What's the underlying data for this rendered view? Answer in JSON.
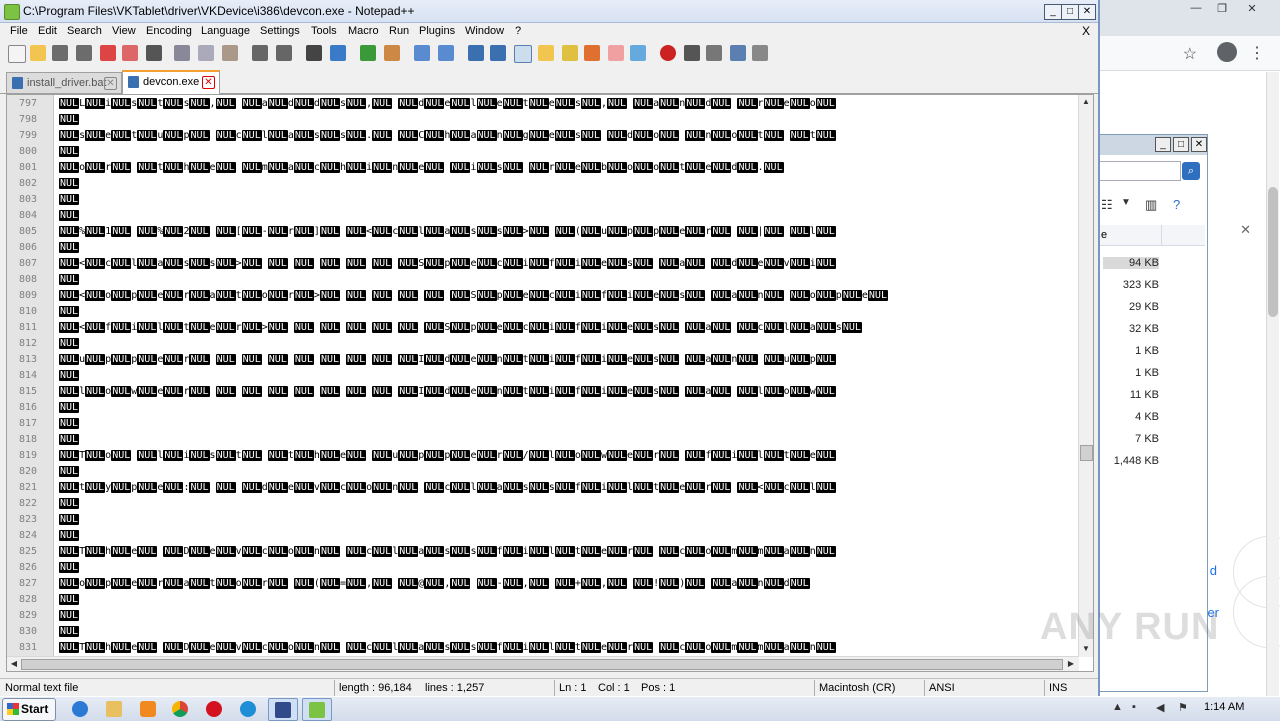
{
  "window": {
    "title": "C:\\Program Files\\VKTablet\\driver\\VKDevice\\i386\\devcon.exe - Notepad++",
    "min": "_",
    "max": "□",
    "close": "✕"
  },
  "menu": {
    "items": [
      "File",
      "Edit",
      "Search",
      "View",
      "Encoding",
      "Language",
      "Settings",
      "Tools",
      "Macro",
      "Run",
      "Plugins",
      "Window",
      "?"
    ],
    "close": "X"
  },
  "tabs": [
    {
      "label": "install_driver.bat",
      "close": "✕",
      "active": false
    },
    {
      "label": "devcon.exe",
      "close": "✕",
      "active": true
    }
  ],
  "editor": {
    "lines": [
      {
        "n": "797",
        "t": "NULLNULiNULsNULtNULsNUL,NUL NULaNULdNULdNULsNUL,NUL NULdNULeNULlNULeNULtNULeNULsNUL,NUL NULaNULnNULdNUL NULrNULeNULoNUL"
      },
      {
        "n": "798",
        "t": "NUL"
      },
      {
        "n": "799",
        "t": "NULsNULeNULtNULuNULpNUL NULcNULlNULaNULsNULsNUL.NUL NULCNULhNULaNULnNULgNULeNULsNUL NULdNULoNUL NULnNULoNULtNUL NULtNUL"
      },
      {
        "n": "800",
        "t": "NUL"
      },
      {
        "n": "801",
        "t": "NULoNULrNUL NULtNULhNULeNUL NULmNULaNULcNULhNULiNULnNULeNUL NULiNULsNUL NULrNULeNULbNULoNULoNULtNULeNULdNUL.NUL"
      },
      {
        "n": "802",
        "t": "NUL"
      },
      {
        "n": "803",
        "t": "NUL"
      },
      {
        "n": "804",
        "t": "NUL"
      },
      {
        "n": "805",
        "t": "NUL%NUL1NUL NUL%NUL2NUL NUL[NUL-NULrNUL]NUL NUL<NULcNULlNULaNULsNULsNUL>NUL NUL(NULuNULpNULpNULeNULrNUL NUL|NUL NULlNUL"
      },
      {
        "n": "806",
        "t": "NUL"
      },
      {
        "n": "807",
        "t": "NUL<NULcNULlNULaNULsNULsNUL>NUL NUL NUL NUL NUL NUL NULSNULpNULeNULcNULiNULfNULiNULeNULsNUL NULaNUL NULdNULeNULvNULiNUL"
      },
      {
        "n": "808",
        "t": "NUL"
      },
      {
        "n": "809",
        "t": "NUL<NULoNULpNULeNULrNULaNULtNULoNULrNUL>NUL NUL NUL NUL NUL NULSNULpNULeNULcNULiNULfNULiNULeNULsNUL NULaNULnNUL NULoNULpNULeNUL"
      },
      {
        "n": "810",
        "t": "NUL"
      },
      {
        "n": "811",
        "t": "NUL<NULfNULiNULlNULtNULeNULrNUL>NUL NUL NUL NUL NUL NUL NULSNULpNULeNULcNULiNULfNULiNULeNULsNUL NULaNUL NULcNULlNULaNULsNUL"
      },
      {
        "n": "812",
        "t": "NUL"
      },
      {
        "n": "813",
        "t": "NULuNULpNULpNULeNULrNUL NUL NUL NUL NUL NUL NUL NUL NULINULdNULeNULnNULtNULiNULfNULiNULeNULsNUL NULaNULnNUL NULuNULpNUL"
      },
      {
        "n": "814",
        "t": "NUL"
      },
      {
        "n": "815",
        "t": "NULlNULoNULwNULeNULrNUL NUL NUL NUL NUL NUL NUL NUL NULINULdNULeNULnNULtNULiNULfNULiNULeNULsNUL NULaNUL NULlNULoNULwNUL"
      },
      {
        "n": "816",
        "t": "NUL"
      },
      {
        "n": "817",
        "t": "NUL"
      },
      {
        "n": "818",
        "t": "NUL"
      },
      {
        "n": "819",
        "t": "NULTNULoNUL NULlNULiNULsNULtNUL NULtNULhNULeNUL NULuNULpNULpNULeNULrNUL/NULlNULoNULwNULeNULrNUL NULfNULiNULlNULtNULeNUL"
      },
      {
        "n": "820",
        "t": "NUL"
      },
      {
        "n": "821",
        "t": "NULtNULyNULpNULeNUL:NUL NUL NULdNULeNULvNULcNULoNULnNUL NULcNULlNULaNULsNULsNULfNULiNULlNULtNULeNULrNUL NUL<NULcNULlNUL"
      },
      {
        "n": "822",
        "t": "NUL"
      },
      {
        "n": "823",
        "t": "NUL"
      },
      {
        "n": "824",
        "t": "NUL"
      },
      {
        "n": "825",
        "t": "NULTNULhNULeNUL NULDNULeNULvNULcNULoNULnNUL NULcNULlNULaNULsNULsNULfNULiNULlNULtNULeNULrNUL NULcNULoNULmNULmNULaNULnNUL"
      },
      {
        "n": "826",
        "t": "NUL"
      },
      {
        "n": "827",
        "t": "NULoNULpNULeNULrNULaNULtNULoNULrNUL NUL(NUL=NUL,NUL NUL@NUL,NUL NUL-NUL,NUL NUL+NUL,NUL NUL!NUL)NUL NULaNULnNULdNUL"
      },
      {
        "n": "828",
        "t": "NUL"
      },
      {
        "n": "829",
        "t": "NUL"
      },
      {
        "n": "830",
        "t": "NUL"
      },
      {
        "n": "831",
        "t": "NULTNULhNULeNUL NULDNULeNULvNULcNULoNULnNUL NULcNULlNULaNULsNULsNULfNULiNULlNULtNULeNULrNUL NULcNULoNULmNULmNULaNULnNUL"
      }
    ]
  },
  "status": {
    "type": "Normal text file",
    "length": "length : 96,184",
    "lines": "lines : 1,257",
    "ln": "Ln : 1",
    "col": "Col : 1",
    "pos": "Pos : 1",
    "eol": "Macintosh (CR)",
    "encoding": "ANSI",
    "mode": "INS"
  },
  "explorer": {
    "column": "e",
    "sizes": [
      "94 KB",
      "323 KB",
      "29 KB",
      "32 KB",
      "1 KB",
      "1 KB",
      "11 KB",
      "4 KB",
      "7 KB",
      "1,448 KB"
    ]
  },
  "chrome": {
    "link1": "d",
    "link2": "er"
  },
  "taskbar": {
    "start": "Start",
    "clock": "1:14 AM"
  },
  "watermark": "ANY RUN"
}
